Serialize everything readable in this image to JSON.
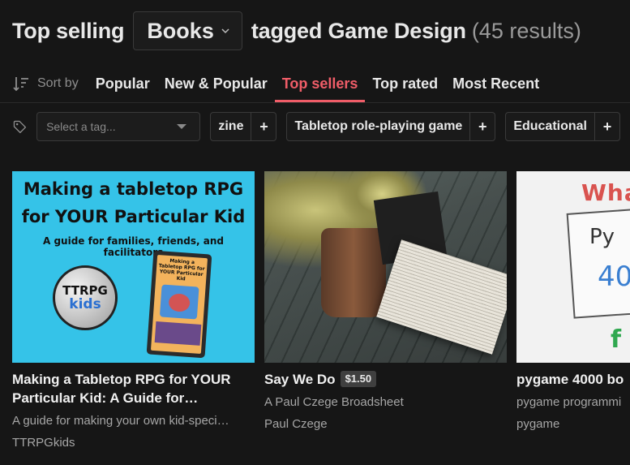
{
  "header": {
    "prefix": "Top selling",
    "classification": "Books",
    "suffix": "tagged Game Design",
    "count": "(45 results)"
  },
  "sort": {
    "label": "Sort by",
    "tabs": [
      {
        "label": "Popular",
        "active": false
      },
      {
        "label": "New & Popular",
        "active": false
      },
      {
        "label": "Top sellers",
        "active": true
      },
      {
        "label": "Top rated",
        "active": false
      },
      {
        "label": "Most Recent",
        "active": false
      }
    ]
  },
  "tags": {
    "placeholder": "Select a tag...",
    "suggested": [
      "zine",
      "Tabletop role-playing game",
      "Educational"
    ],
    "plus": "+"
  },
  "games": [
    {
      "title": "Making a Tabletop RPG for YOUR Particular Kid: A Guide for…",
      "price": "",
      "description": "A guide for making your own kid-speci…",
      "author": "TTRPGkids",
      "cover": {
        "line1": "Making a tabletop RPG",
        "line2": "for YOUR Particular Kid",
        "line3": "A guide for families, friends, and facilitators",
        "logo_top": "TTRPG",
        "logo_bottom": "kids",
        "book_title": "Making a Tabletop RPG for YOUR Particular Kid"
      }
    },
    {
      "title": "Say We Do",
      "price": "$1.50",
      "description": "A Paul Czege Broadsheet",
      "author": "Paul Czege"
    },
    {
      "title": "pygame 4000 bo",
      "price": "",
      "description": "pygame programmi",
      "author": "pygame",
      "cover": {
        "top": "Wha",
        "mid": "Py",
        "num": "40",
        "bottom": "f"
      }
    }
  ],
  "colors": {
    "background": "#161616",
    "accent": "#f05d68",
    "cover1_bg": "#35c3e8"
  }
}
